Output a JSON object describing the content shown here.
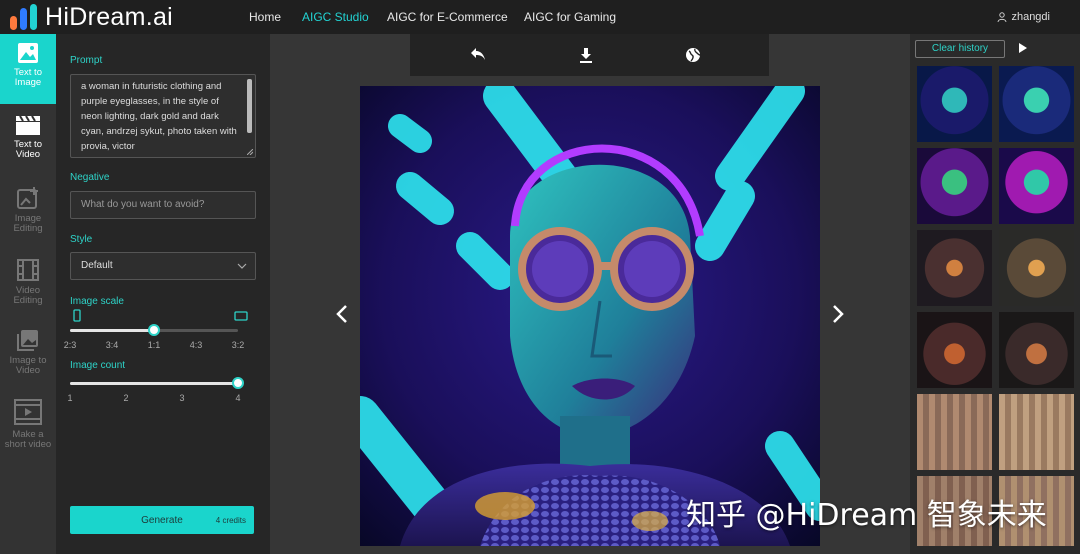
{
  "brand": {
    "name": "HiDream.ai",
    "bar_colors": [
      "#ff7a3d",
      "#2f7bff",
      "#22d3d3"
    ]
  },
  "nav": {
    "items": [
      {
        "label": "Home"
      },
      {
        "label": "AIGC Studio"
      },
      {
        "label": "AIGC for E-Commerce"
      },
      {
        "label": "AIGC for Gaming"
      }
    ],
    "active_index": 1,
    "user": "zhangdi"
  },
  "sidebar": {
    "items": [
      {
        "label_1": "Text to",
        "label_2": "Image",
        "icon": "image-icon"
      },
      {
        "label_1": "Text to",
        "label_2": "Video",
        "icon": "clapperboard-icon"
      },
      {
        "label_1": "Image",
        "label_2": "Editing",
        "icon": "image-edit-icon"
      },
      {
        "label_1": "Video",
        "label_2": "Editing",
        "icon": "film-edit-icon"
      },
      {
        "label_1": "Image to",
        "label_2": "Video",
        "icon": "images-icon"
      },
      {
        "label_1": "Make a",
        "label_2": "short video",
        "icon": "video-strip-icon"
      }
    ]
  },
  "panel": {
    "prompt_label": "Prompt",
    "prompt_value": "a woman in futuristic clothing and purple eyeglasses, in the style of neon lighting, dark gold and dark cyan, andrzej sykut, photo taken with provia, victor",
    "negative_label": "Negative",
    "negative_placeholder": "What do you want to avoid?",
    "style_label": "Style",
    "style_value": "Default",
    "scale_label": "Image scale",
    "scale_ticks": [
      "2:3",
      "3:4",
      "1:1",
      "4:3",
      "3:2"
    ],
    "scale_selected": "1:1",
    "count_label": "Image count",
    "count_ticks": [
      "1",
      "2",
      "3",
      "4"
    ],
    "count_selected": 4,
    "generate_label": "Generate",
    "credits": "4 credits"
  },
  "history": {
    "clear_label": "Clear history"
  },
  "watermark": "知乎 @HiDream 智象未来",
  "colors": {
    "accent": "#1ad5cc",
    "topbar": "#1f1f1f",
    "panel": "#262626",
    "viewer": "#363636"
  }
}
